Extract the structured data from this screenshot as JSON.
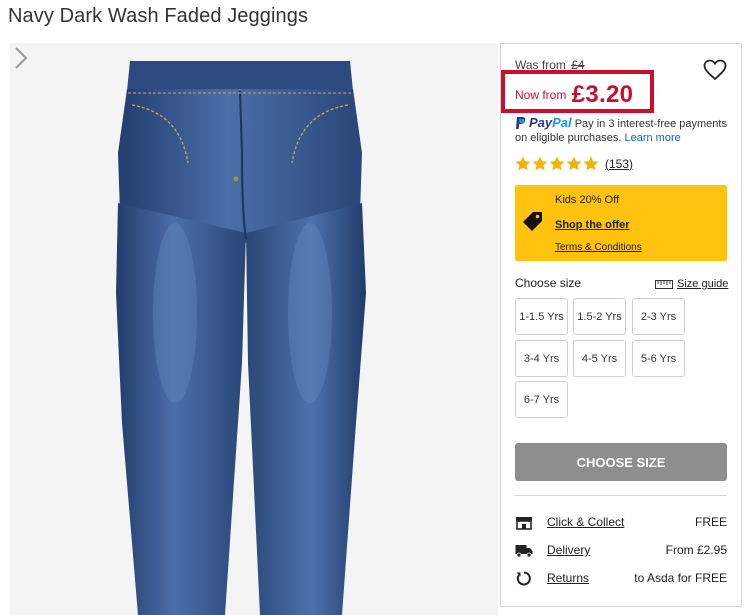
{
  "product": {
    "title": "Navy Dark Wash Faded Jeggings"
  },
  "pricing": {
    "was_label": "Was from",
    "was_price": "£4",
    "now_label": "Now from",
    "now_price": "£3.20"
  },
  "paypal": {
    "logo_pay": "Pay",
    "logo_pal": "Pal",
    "text": "Pay in 3 interest-free payments on eligible purchases.",
    "learn_more": "Learn more"
  },
  "rating": {
    "stars": 5,
    "count": "(153)"
  },
  "promo": {
    "title": "Kids 20% Off",
    "shop": "Shop the offer",
    "terms": "Terms & Conditions",
    "color": "#ffc20e"
  },
  "sizes": {
    "label": "Choose size",
    "guide": "Size guide",
    "options": [
      "1-1.5 Yrs",
      "1.5-2 Yrs",
      "2-3 Yrs",
      "3-4 Yrs",
      "4-5 Yrs",
      "5-6 Yrs",
      "6-7 Yrs"
    ]
  },
  "cta": {
    "label": "CHOOSE SIZE"
  },
  "delivery": [
    {
      "icon": "store-icon",
      "label": "Click & Collect",
      "value": "FREE"
    },
    {
      "icon": "truck-icon",
      "label": "Delivery",
      "value": "From £2.95"
    },
    {
      "icon": "returns-icon",
      "label": "Returns",
      "value": "to Asda for FREE"
    }
  ],
  "colors": {
    "sale_red": "#c8102e",
    "button_grey": "#8e8e8e",
    "star_yellow": "#f5b301",
    "denim": "#2f4f86"
  }
}
